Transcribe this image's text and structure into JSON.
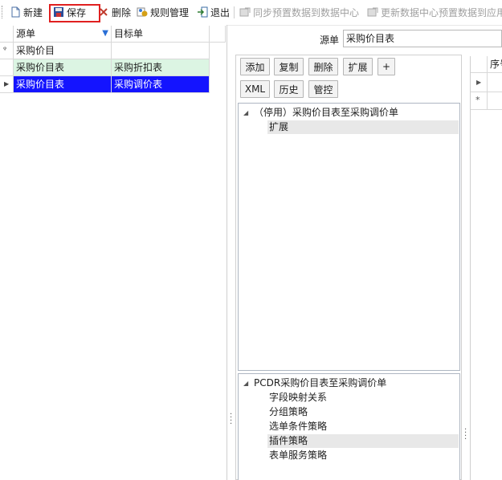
{
  "toolbar": {
    "new_label": "新建",
    "save_label": "保存",
    "delete_label": "删除",
    "rules_label": "规则管理",
    "exit_label": "退出",
    "sync_label": "同步预置数据到数据中心",
    "update_label": "更新数据中心预置数据到应用"
  },
  "left_grid": {
    "headers": [
      "源单",
      "目标单"
    ],
    "filter_row_value": "采购价目",
    "rows": [
      {
        "source": "采购价目表",
        "target": "采购折扣表"
      },
      {
        "source": "采购价目表",
        "target": "采购调价表"
      }
    ]
  },
  "source_field": {
    "label": "源单",
    "value": "采购价目表"
  },
  "buttons": {
    "add": "添加",
    "copy": "复制",
    "delete": "删除",
    "extend": "扩展",
    "plus": "+",
    "xml": "XML",
    "history": "历史",
    "control": "管控"
  },
  "top_tree": {
    "root": "（停用）采购价目表至采购调价单",
    "children": [
      "扩展"
    ]
  },
  "bottom_tree": {
    "root": "PCDR采购价目表至采购调价单",
    "children": [
      "字段映射关系",
      "分组策略",
      "选单条件策略",
      "插件策略",
      "表单服务策略"
    ]
  },
  "right_grid": {
    "header": "序号"
  },
  "colors": {
    "selected_row": "#1414ff",
    "green_row": "#dcf5e3",
    "highlight_box": "#e02020"
  }
}
